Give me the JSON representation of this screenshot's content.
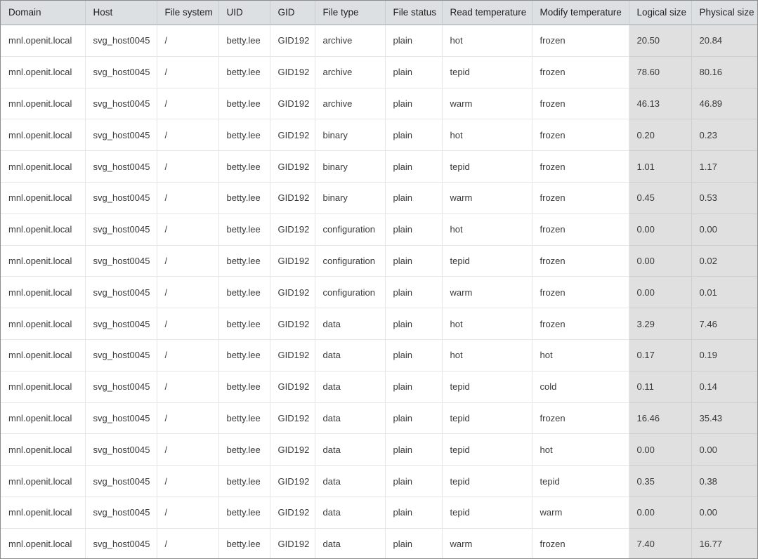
{
  "table": {
    "columns": [
      "Domain",
      "Host",
      "File system",
      "UID",
      "GID",
      "File type",
      "File status",
      "Read temperature",
      "Modify temperature",
      "Logical size",
      "Physical size"
    ],
    "rows": [
      [
        "mnl.openit.local",
        "svg_host0045",
        "/",
        "betty.lee",
        "GID192",
        "archive",
        "plain",
        "hot",
        "frozen",
        "20.50",
        "20.84"
      ],
      [
        "mnl.openit.local",
        "svg_host0045",
        "/",
        "betty.lee",
        "GID192",
        "archive",
        "plain",
        "tepid",
        "frozen",
        "78.60",
        "80.16"
      ],
      [
        "mnl.openit.local",
        "svg_host0045",
        "/",
        "betty.lee",
        "GID192",
        "archive",
        "plain",
        "warm",
        "frozen",
        "46.13",
        "46.89"
      ],
      [
        "mnl.openit.local",
        "svg_host0045",
        "/",
        "betty.lee",
        "GID192",
        "binary",
        "plain",
        "hot",
        "frozen",
        "0.20",
        "0.23"
      ],
      [
        "mnl.openit.local",
        "svg_host0045",
        "/",
        "betty.lee",
        "GID192",
        "binary",
        "plain",
        "tepid",
        "frozen",
        "1.01",
        "1.17"
      ],
      [
        "mnl.openit.local",
        "svg_host0045",
        "/",
        "betty.lee",
        "GID192",
        "binary",
        "plain",
        "warm",
        "frozen",
        "0.45",
        "0.53"
      ],
      [
        "mnl.openit.local",
        "svg_host0045",
        "/",
        "betty.lee",
        "GID192",
        "configuration",
        "plain",
        "hot",
        "frozen",
        "0.00",
        "0.00"
      ],
      [
        "mnl.openit.local",
        "svg_host0045",
        "/",
        "betty.lee",
        "GID192",
        "configuration",
        "plain",
        "tepid",
        "frozen",
        "0.00",
        "0.02"
      ],
      [
        "mnl.openit.local",
        "svg_host0045",
        "/",
        "betty.lee",
        "GID192",
        "configuration",
        "plain",
        "warm",
        "frozen",
        "0.00",
        "0.01"
      ],
      [
        "mnl.openit.local",
        "svg_host0045",
        "/",
        "betty.lee",
        "GID192",
        "data",
        "plain",
        "hot",
        "frozen",
        "3.29",
        "7.46"
      ],
      [
        "mnl.openit.local",
        "svg_host0045",
        "/",
        "betty.lee",
        "GID192",
        "data",
        "plain",
        "hot",
        "hot",
        "0.17",
        "0.19"
      ],
      [
        "mnl.openit.local",
        "svg_host0045",
        "/",
        "betty.lee",
        "GID192",
        "data",
        "plain",
        "tepid",
        "cold",
        "0.11",
        "0.14"
      ],
      [
        "mnl.openit.local",
        "svg_host0045",
        "/",
        "betty.lee",
        "GID192",
        "data",
        "plain",
        "tepid",
        "frozen",
        "16.46",
        "35.43"
      ],
      [
        "mnl.openit.local",
        "svg_host0045",
        "/",
        "betty.lee",
        "GID192",
        "data",
        "plain",
        "tepid",
        "hot",
        "0.00",
        "0.00"
      ],
      [
        "mnl.openit.local",
        "svg_host0045",
        "/",
        "betty.lee",
        "GID192",
        "data",
        "plain",
        "tepid",
        "tepid",
        "0.35",
        "0.38"
      ],
      [
        "mnl.openit.local",
        "svg_host0045",
        "/",
        "betty.lee",
        "GID192",
        "data",
        "plain",
        "tepid",
        "warm",
        "0.00",
        "0.00"
      ],
      [
        "mnl.openit.local",
        "svg_host0045",
        "/",
        "betty.lee",
        "GID192",
        "data",
        "plain",
        "warm",
        "frozen",
        "7.40",
        "16.77"
      ]
    ]
  }
}
